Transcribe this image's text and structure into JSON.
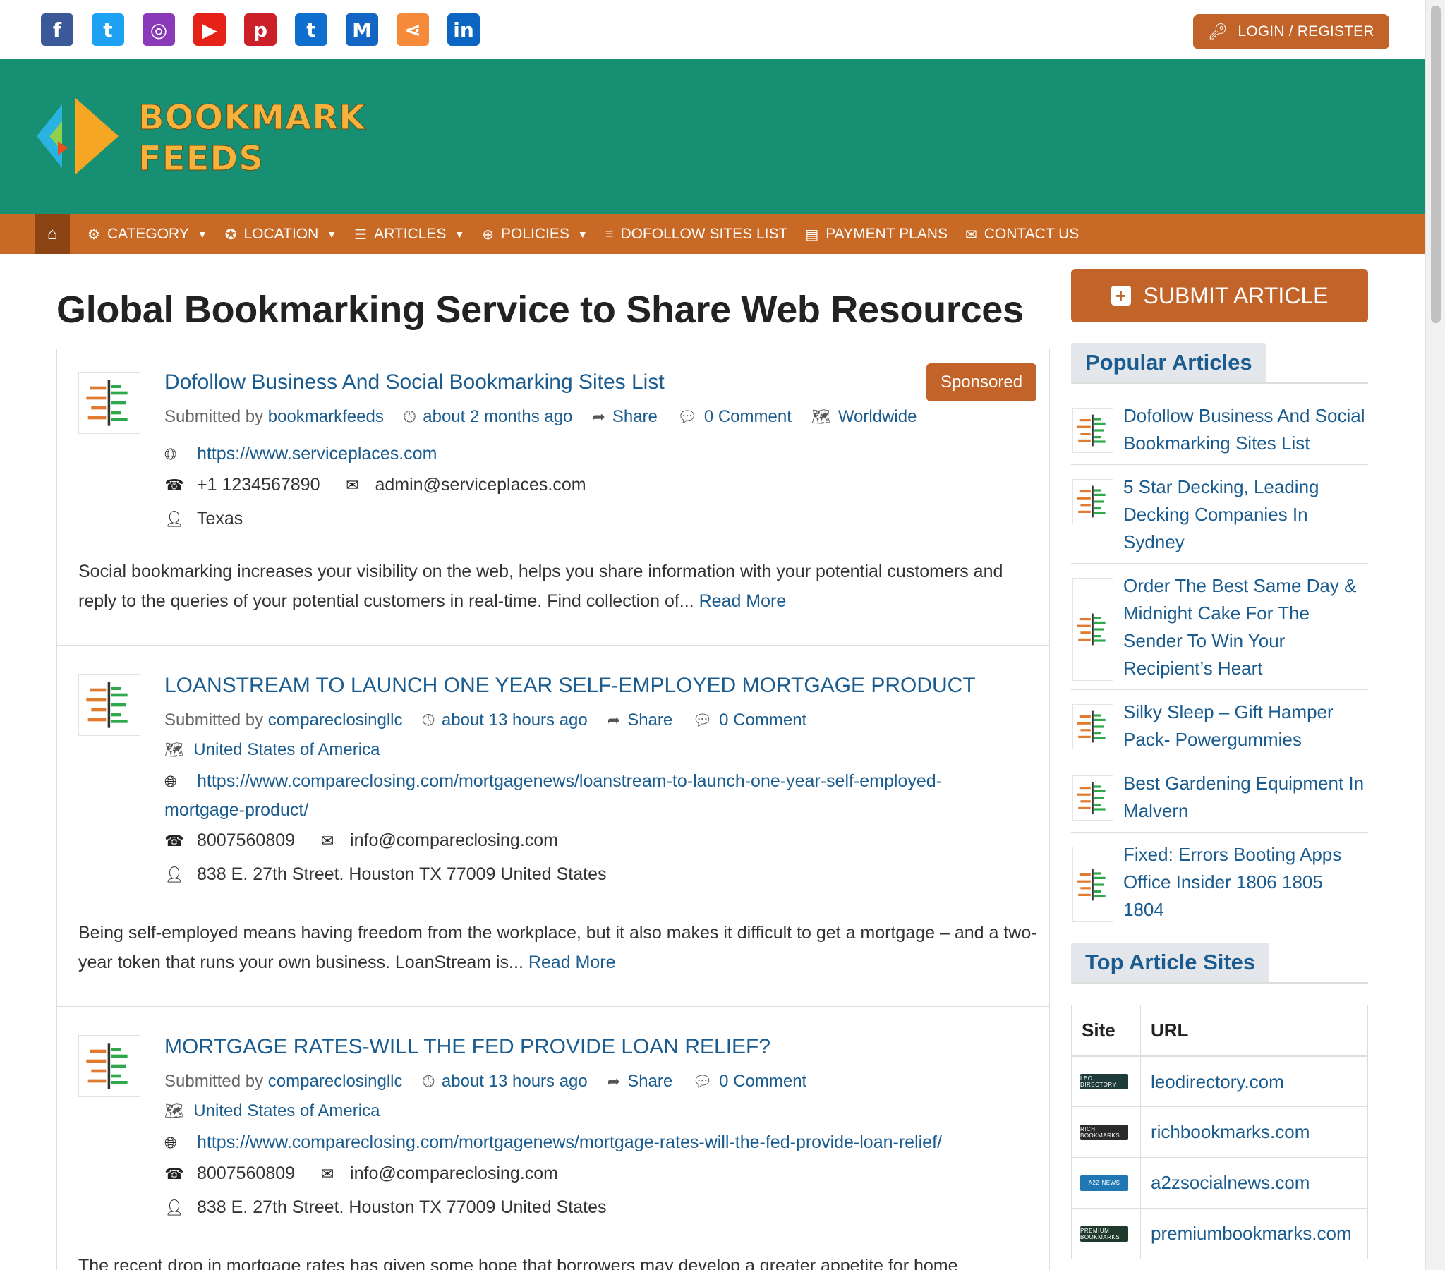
{
  "topbar": {
    "social_icons": [
      {
        "name": "facebook-icon",
        "glyph": "f",
        "color": "#3b5998"
      },
      {
        "name": "twitter-icon",
        "glyph": "t",
        "color": "#1da1f2"
      },
      {
        "name": "instagram-icon",
        "glyph": "◎",
        "color": "#8a3ab9"
      },
      {
        "name": "youtube-icon",
        "glyph": "▶",
        "color": "#e62117"
      },
      {
        "name": "pinterest-icon",
        "glyph": "p",
        "color": "#cb2027"
      },
      {
        "name": "tumblr-icon",
        "glyph": "t",
        "color": "#0e6fcf"
      },
      {
        "name": "medium-icon",
        "glyph": "M",
        "color": "#1366c4"
      },
      {
        "name": "share-icon",
        "glyph": "⋖",
        "color": "#f58a3a"
      },
      {
        "name": "linkedin-icon",
        "glyph": "in",
        "color": "#0a66c2"
      }
    ],
    "login_label": "LOGIN / REGISTER"
  },
  "header": {
    "logo_line1": "BOOKMARK",
    "logo_line2": "FEEDS"
  },
  "nav": {
    "items": [
      {
        "label": "CATEGORY",
        "icon": "⚙",
        "caret": true
      },
      {
        "label": "LOCATION",
        "icon": "✪",
        "caret": true
      },
      {
        "label": "ARTICLES",
        "icon": "☰",
        "caret": true
      },
      {
        "label": "POLICIES",
        "icon": "⊕",
        "caret": true
      },
      {
        "label": "DOFOLLOW SITES LIST",
        "icon": "≡",
        "caret": false
      },
      {
        "label": "PAYMENT PLANS",
        "icon": "▤",
        "caret": false
      },
      {
        "label": "CONTACT US",
        "icon": "✉",
        "caret": false
      }
    ]
  },
  "main": {
    "title": "Global Bookmarking Service to Share Web Resources",
    "articles": [
      {
        "title": "Dofollow Business And Social Bookmarking Sites List",
        "sponsored": "Sponsored",
        "submitted_by_label": "Submitted by",
        "author": "bookmarkfeeds",
        "time": "about 2 months ago",
        "share": "Share",
        "comments": "0 Comment",
        "location": "Worldwide",
        "url": "https://www.serviceplaces.com",
        "phone": "+1 1234567890",
        "email": "admin@serviceplaces.com",
        "address": "Texas",
        "excerpt": "Social bookmarking increases your visibility on the web, helps you share information with your potential customers and reply to the queries of your potential customers in real-time. Find collection of...",
        "read_more": "Read More"
      },
      {
        "title": "LOANSTREAM TO LAUNCH ONE YEAR SELF-EMPLOYED MORTGAGE PRODUCT",
        "submitted_by_label": "Submitted by",
        "author": "compareclosingllc",
        "time": "about 13 hours ago",
        "share": "Share",
        "comments": "0 Comment",
        "location": "United States of America",
        "url": "https://www.compareclosing.com/mortgagenews/loanstream-to-launch-one-year-self-employed-mortgage-product/",
        "phone": "8007560809",
        "email": "info@compareclosing.com",
        "address": "838 E. 27th Street. Houston TX 77009 United States",
        "excerpt": "Being self-employed means having freedom from the workplace, but it also makes it difficult to get a mortgage – and a two-year token that runs your own business. LoanStream is...",
        "read_more": "Read More"
      },
      {
        "title": "MORTGAGE RATES-WILL THE FED PROVIDE LOAN RELIEF?",
        "submitted_by_label": "Submitted by",
        "author": "compareclosingllc",
        "time": "about 13 hours ago",
        "share": "Share",
        "comments": "0 Comment",
        "location": "United States of America",
        "url": "https://www.compareclosing.com/mortgagenews/mortgage-rates-will-the-fed-provide-loan-relief/",
        "phone": "8007560809",
        "email": "info@compareclosing.com",
        "address": "838 E. 27th Street. Houston TX 77009 United States",
        "excerpt": "The recent drop in mortgage rates has given some hope that borrowers may develop a greater appetite for home",
        "read_more": ""
      }
    ]
  },
  "sidebar": {
    "submit_label": "SUBMIT ARTICLE",
    "popular_heading": "Popular Articles",
    "popular": [
      "Dofollow Business And Social Bookmarking Sites List",
      "5 Star Decking, Leading Decking Companies In Sydney",
      "Order The Best Same Day & Midnight Cake For The Sender To Win Your Recipient’s Heart",
      "Silky Sleep – Gift Hamper Pack- Powergummies",
      "Best Gardening Equipment In Malvern",
      "Fixed: Errors Booting Apps Office Insider 1806 1805 1804"
    ],
    "top_sites_heading": "Top Article Sites",
    "table_headers": {
      "site": "Site",
      "url": "URL"
    },
    "sites": [
      {
        "url": "leodirectory.com",
        "logo_text": "LEO DIRECTORY",
        "logo_color": "#1d3b3a"
      },
      {
        "url": "richbookmarks.com",
        "logo_text": "RICH BOOKMARKS",
        "logo_color": "#2a2a2a"
      },
      {
        "url": "a2zsocialnews.com",
        "logo_text": "A2Z NEWS",
        "logo_color": "#1f78b4"
      },
      {
        "url": "premiumbookmarks.com",
        "logo_text": "PREMIUM BOOKMARKS",
        "logo_color": "#1f3a2c"
      }
    ]
  }
}
